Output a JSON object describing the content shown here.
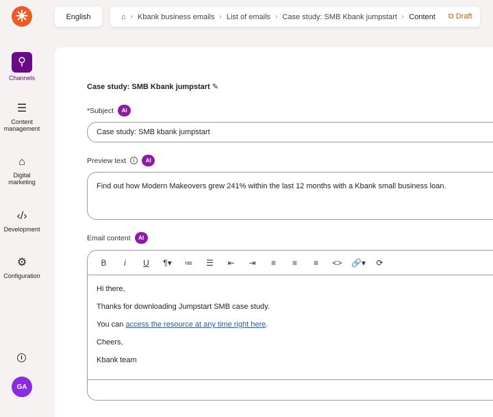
{
  "header": {
    "language": "English",
    "breadcrumbs": [
      "Kbank business emails",
      "List of emails",
      "Case study: SMB Kbank jumpstart",
      "Content"
    ],
    "status": "Draft"
  },
  "sidebar": {
    "items": [
      {
        "label": "Channels",
        "icon": "channels-icon"
      },
      {
        "label": "Content management",
        "icon": "list-icon"
      },
      {
        "label": "Digital marketing",
        "icon": "store-icon"
      },
      {
        "label": "Development",
        "icon": "code-icon"
      },
      {
        "label": "Configuration",
        "icon": "gears-icon"
      }
    ],
    "avatar": "GA"
  },
  "form": {
    "title": "Case study: SMB Kbank jumpstart",
    "ai": "AI",
    "subject_label": "*Subject",
    "subject_value": "Case study: SMB kbank jumpstart",
    "preview_label": "Preview text",
    "preview_value": "Find out how Modern Makeovers grew 241% within the last 12 months with a Kbank small business loan.",
    "content_label": "Email content",
    "content": {
      "greeting": "Hi there,",
      "line1": "Thanks for downloading Jumpstart SMB case study.",
      "line2_prefix": "You can ",
      "link": "access the resource at any time right here",
      "line2_suffix": ".",
      "closing": "Cheers,",
      "signature": "Kbank team"
    }
  },
  "toolbar": [
    "B",
    "i",
    "U",
    "¶▾",
    "≔",
    "☰",
    "⇤",
    "⇥",
    "≡",
    "≡",
    "≡",
    "<>",
    "🔗▾",
    "⟳"
  ]
}
